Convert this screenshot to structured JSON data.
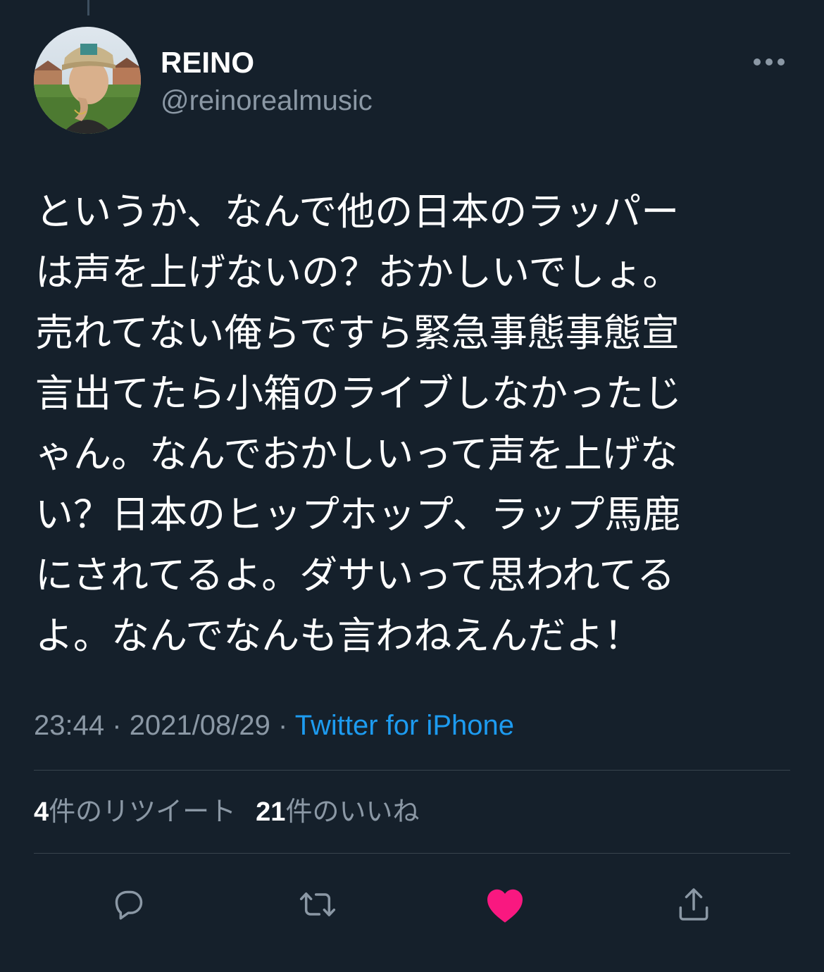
{
  "tweet": {
    "author": {
      "display_name": "REINO",
      "handle": "@reinorealmusic"
    },
    "text": "というか、なんで他の日本のラッパー\nは声を上げないの？おかしいでしょ。\n売れてない俺らですら緊急事態事態宣\n言出てたら小箱のライブしなかったじ\nゃん。なんでおかしいって声を上げな\nい？日本のヒップホップ、ラップ馬鹿\nにされてるよ。ダサいって思われてる\nよ。なんでなんも言わねえんだよ！",
    "time": "23:44",
    "date": "2021/08/29",
    "separator": "·",
    "source": "Twitter for iPhone",
    "retweets": {
      "count": "4",
      "label": "件のリツイート"
    },
    "likes": {
      "count": "21",
      "label": "件のいいね"
    },
    "liked": true
  },
  "icons": {
    "more": "more-horizontal-icon",
    "reply": "reply-icon",
    "retweet": "retweet-icon",
    "like": "heart-icon",
    "share": "share-icon"
  },
  "colors": {
    "background": "#15202b",
    "text": "#ffffff",
    "secondary": "#8b98a5",
    "link": "#1d9bf0",
    "like": "#f91880",
    "divider": "#38444d"
  }
}
